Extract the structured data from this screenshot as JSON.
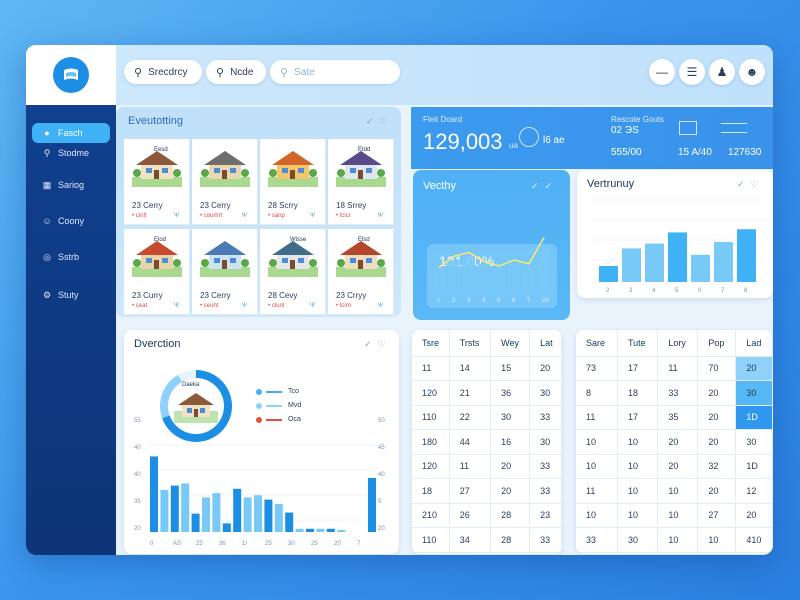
{
  "search": {
    "pill1": "Srecdrcy",
    "pill2": "Ncde",
    "pill3_placeholder": "Sate"
  },
  "topbar_icons": [
    "minus-icon",
    "bars-icon",
    "people-icon",
    "user-icon"
  ],
  "sidebar": {
    "items": [
      {
        "label": "Fasch",
        "icon": "circle-icon",
        "active": true
      },
      {
        "label": "Stodme",
        "icon": "search-icon",
        "active": false
      },
      {
        "label": "Sariog",
        "icon": "grid-icon",
        "active": false
      },
      {
        "label": "Coony",
        "icon": "person-icon",
        "active": false
      },
      {
        "label": "Sstrb",
        "icon": "globe-icon",
        "active": false
      },
      {
        "label": "Stuty",
        "icon": "gear-icon",
        "active": false
      }
    ]
  },
  "listings": {
    "title": "Eveutotting",
    "cards": [
      {
        "label": "Eesd",
        "price": "23 Cerry",
        "sub": "• cinlt",
        "tag": "Ψ"
      },
      {
        "label": "",
        "price": "23 Cerry",
        "sub": "• coumrt",
        "tag": "Ψ"
      },
      {
        "label": "",
        "price": "28 Scrry",
        "sub": "• sanp",
        "tag": "Ψ"
      },
      {
        "label": "Etdd",
        "price": "18 Srrey",
        "sub": "• tcicr",
        "tag": "Ψ"
      },
      {
        "label": "Elod",
        "price": "23 Curry",
        "sub": "• ceat",
        "tag": "Ψ"
      },
      {
        "label": "",
        "price": "23 Cerry",
        "sub": "• ceuht",
        "tag": "Ψ"
      },
      {
        "label": "Wisse",
        "price": "28 Cevy",
        "sub": "• clunt",
        "tag": "Ψ"
      },
      {
        "label": "Elsd",
        "price": "23 Crryy",
        "sub": "• tcirn",
        "tag": "Ψ"
      }
    ]
  },
  "stats": {
    "label_left": "Fleit Doard",
    "big_value": "129,003",
    "unit": "ua",
    "mid_value": "l6 ae",
    "label_right": "Rescote Gouts",
    "right_top": "02 ЭS",
    "values": [
      "555/00",
      "15 A/40",
      "127630"
    ]
  },
  "vecthy": {
    "title": "Vecthy",
    "headline": "131,00%",
    "chart_data": {
      "type": "line",
      "values": [
        30,
        45,
        50,
        38,
        32,
        40,
        35,
        70
      ],
      "bars": [
        28,
        40,
        45,
        35,
        30,
        38,
        33,
        60
      ]
    },
    "x_ticks": [
      "1",
      "2",
      "3",
      "4",
      "5",
      "6",
      "7",
      "20"
    ]
  },
  "vertrunuy": {
    "title": "Vertrunuy",
    "chart_data": {
      "type": "bar",
      "values": [
        20,
        42,
        48,
        62,
        34,
        50,
        66
      ],
      "ylim": [
        0,
        100
      ]
    },
    "x_ticks": [
      "2",
      "3",
      "4",
      "5",
      "0",
      "7",
      "8"
    ]
  },
  "overview": {
    "title": "Dverction",
    "legend": [
      {
        "label": "Tco",
        "color": "#3fb2f5"
      },
      {
        "label": "Mvd",
        "color": "#8fd1fa"
      },
      {
        "label": "Oca",
        "color": "#e0513f"
      }
    ],
    "house_label": "Daeka",
    "chart_data": {
      "type": "bar",
      "values": [
        70,
        39,
        43,
        45,
        17,
        32,
        36,
        8,
        40,
        32,
        34,
        30,
        26,
        18,
        3,
        3,
        3,
        3,
        2,
        50
      ],
      "ylim": [
        0,
        100
      ]
    },
    "y_left": [
      "55",
      "40",
      "40",
      "35",
      "20"
    ],
    "y_right": [
      "50",
      "45",
      "40",
      "5",
      "20"
    ],
    "x_ticks": [
      "0",
      "AS",
      "25",
      "36",
      "1/",
      "25",
      "30",
      "25",
      "20",
      "7"
    ]
  },
  "table1": {
    "headers": [
      "Tsre",
      "Trsts",
      "Wey",
      "Lat"
    ],
    "rows": [
      [
        "11",
        "14",
        "15",
        "20"
      ],
      [
        "120",
        "21",
        "36",
        "30"
      ],
      [
        "110",
        "22",
        "30",
        "33"
      ],
      [
        "180",
        "44",
        "16",
        "30"
      ],
      [
        "120",
        "11",
        "20",
        "33"
      ],
      [
        "18",
        "27",
        "20",
        "33"
      ],
      [
        "210",
        "26",
        "28",
        "23"
      ],
      [
        "110",
        "34",
        "28",
        "33"
      ]
    ]
  },
  "table2": {
    "headers": [
      "Sare",
      "Tute",
      "Lory",
      "Pop",
      "Lad"
    ],
    "rows": [
      [
        "73",
        "17",
        "11",
        "70",
        "20"
      ],
      [
        "8",
        "18",
        "33",
        "20",
        "30"
      ],
      [
        "11",
        "17",
        "35",
        "20",
        "1D"
      ],
      [
        "10",
        "10",
        "20",
        "20",
        "30"
      ],
      [
        "10",
        "10",
        "20",
        "32",
        "1D"
      ],
      [
        "11",
        "10",
        "10",
        "20",
        "12"
      ],
      [
        "10",
        "10",
        "10",
        "27",
        "20"
      ],
      [
        "33",
        "30",
        "10",
        "10",
        "410"
      ]
    ],
    "highlight_colors": [
      "#8fd1fa",
      "#57b8f6",
      "#2f97ee"
    ]
  },
  "colors": {
    "accent": "#3fb2f5",
    "bar_main": "#1c8fe4",
    "bar_light": "#79c9f7",
    "sidebar": "#10408f"
  }
}
